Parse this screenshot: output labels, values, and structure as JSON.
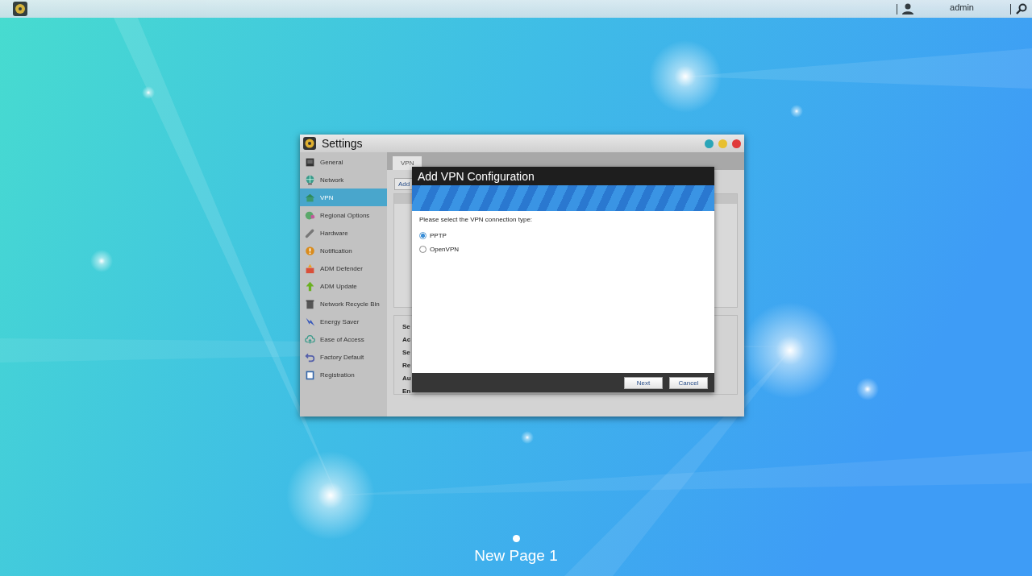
{
  "top_bar": {
    "user": "admin"
  },
  "settings_window": {
    "title": "Settings",
    "sidebar": {
      "items": [
        {
          "label": "General",
          "selected": false
        },
        {
          "label": "Network",
          "selected": false
        },
        {
          "label": "VPN",
          "selected": true
        },
        {
          "label": "Regional Options",
          "selected": false
        },
        {
          "label": "Hardware",
          "selected": false
        },
        {
          "label": "Notification",
          "selected": false
        },
        {
          "label": "ADM Defender",
          "selected": false
        },
        {
          "label": "ADM Update",
          "selected": false
        },
        {
          "label": "Network Recycle Bin",
          "selected": false
        },
        {
          "label": "Energy Saver",
          "selected": false
        },
        {
          "label": "Ease of Access",
          "selected": false
        },
        {
          "label": "Factory Default",
          "selected": false
        },
        {
          "label": "Registration",
          "selected": false
        }
      ]
    },
    "tabs": [
      {
        "label": "VPN",
        "selected": true
      }
    ],
    "add_button": "Add",
    "details": [
      {
        "label": "Se"
      },
      {
        "label": "Ac"
      },
      {
        "label": "Se"
      },
      {
        "label": "Re"
      },
      {
        "label": "Au"
      },
      {
        "label": "En"
      }
    ]
  },
  "dialog": {
    "title": "Add VPN Configuration",
    "prompt": "Please select the VPN connection type:",
    "options": [
      {
        "label": "PPTP",
        "selected": true
      },
      {
        "label": "OpenVPN",
        "selected": false
      }
    ],
    "buttons": [
      "Next",
      "Cancel"
    ]
  },
  "page_indicator": {
    "label": "New Page 1"
  }
}
